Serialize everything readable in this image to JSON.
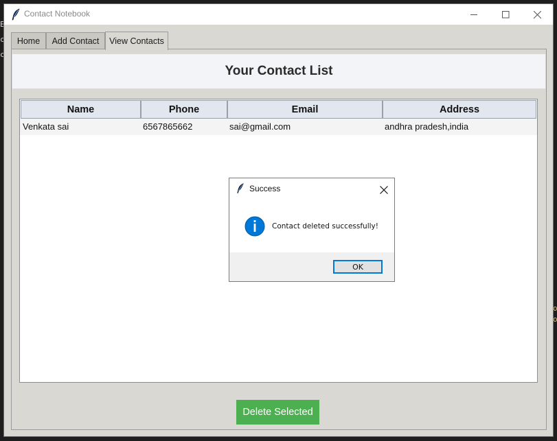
{
  "background": {
    "left_chars": [
      "E",
      "ct",
      "ct"
    ],
    "right_chars": [
      "o",
      "o"
    ]
  },
  "window": {
    "title": "Contact Notebook",
    "app_icon": "feather-icon",
    "controls": [
      "minimize-icon",
      "maximize-icon",
      "close-icon"
    ]
  },
  "tabs": [
    {
      "label": "Home",
      "active": false
    },
    {
      "label": "Add Contact",
      "active": false
    },
    {
      "label": "View Contacts",
      "active": true
    }
  ],
  "main": {
    "heading": "Your Contact List",
    "table": {
      "columns": [
        "Name",
        "Phone",
        "Email",
        "Address"
      ],
      "rows": [
        {
          "name": "Venkata sai",
          "phone": "6567865662",
          "email": "sai@gmail.com",
          "address": "andhra pradesh,india"
        }
      ]
    },
    "delete_button_label": "Delete Selected"
  },
  "dialog": {
    "title": "Success",
    "icon": "info-icon",
    "message": "Contact deleted successfully!",
    "ok_label": "OK"
  },
  "colors": {
    "accent_button": "#4caf50",
    "dialog_focus": "#0078d7",
    "info_icon": "#0078d7"
  }
}
